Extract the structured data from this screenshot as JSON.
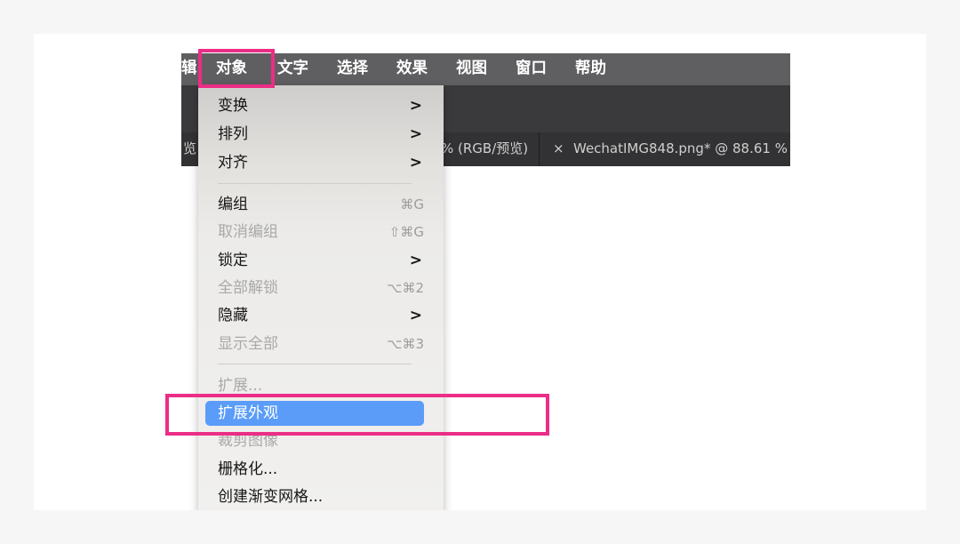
{
  "menubar": {
    "items": [
      {
        "label": "辑"
      },
      {
        "label": "对象"
      },
      {
        "label": "文字"
      },
      {
        "label": "选择"
      },
      {
        "label": "效果"
      },
      {
        "label": "视图"
      },
      {
        "label": "窗口"
      },
      {
        "label": "帮助"
      }
    ]
  },
  "tabs": {
    "left_fragment": "览",
    "middle_fragment": "% (RGB/预览)",
    "close_glyph": "×",
    "active_title": "WechatIMG848.png* @ 88.61 %"
  },
  "object_menu": {
    "items": [
      {
        "label": "变换",
        "arrow": ">"
      },
      {
        "label": "排列",
        "arrow": ">"
      },
      {
        "label": "对齐",
        "arrow": ">"
      },
      {
        "label": "编组",
        "shortcut": "⌘G"
      },
      {
        "label": "取消编组",
        "shortcut": "⇧⌘G"
      },
      {
        "label": "锁定",
        "arrow": ">"
      },
      {
        "label": "全部解锁",
        "shortcut": "⌥⌘2"
      },
      {
        "label": "隐藏",
        "arrow": ">"
      },
      {
        "label": "显示全部",
        "shortcut": "⌥⌘3"
      },
      {
        "label": "扩展..."
      },
      {
        "label": "扩展外观"
      },
      {
        "label": "裁剪图像"
      },
      {
        "label": "栅格化..."
      },
      {
        "label": "创建渐变网格..."
      }
    ]
  },
  "colors": {
    "highlight": "#5a9cf8",
    "annotation": "#ec2d86",
    "menubar_bg": "#5f5f61"
  }
}
